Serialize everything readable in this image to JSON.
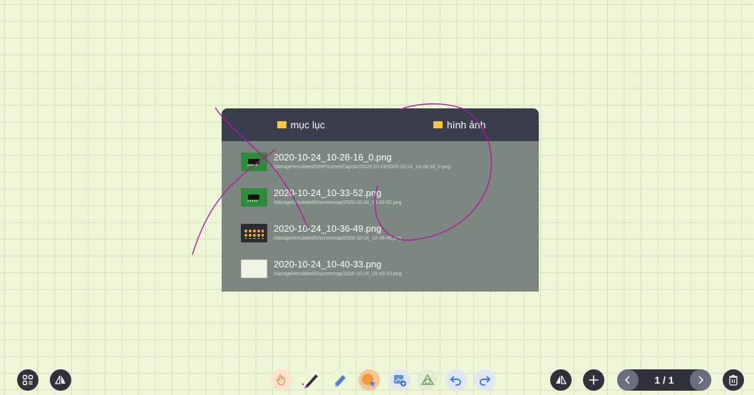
{
  "panel": {
    "tabs": [
      {
        "label": "mục lục",
        "icon": "folder-icon",
        "icon_color": "#f5c842"
      },
      {
        "label": "hình ảnh",
        "icon": "image-icon",
        "icon_color": "#f5c842"
      }
    ],
    "files": [
      {
        "name": "2020-10-24_10-28-16_0.png",
        "path": "/storage/emulated/0/RPScreenCap/pic/2020-10-24/2020-10-24_10-28-16_0.png"
      },
      {
        "name": "2020-10-24_10-33-52.png",
        "path": "/storage/emulated/0/screencap/2020-10-24_10-33-52.png"
      },
      {
        "name": "2020-10-24_10-36-49.png",
        "path": "/storage/emulated/0/screencap/2020-10-24_10-36-49.png"
      },
      {
        "name": "2020-10-24_10-40-33.png",
        "path": "/storage/emulated/0/screencap/2020-10-24_10-40-33.png"
      }
    ]
  },
  "toolbar": {
    "left": [
      "grid-menu-icon",
      "flip-icon"
    ],
    "tools": [
      "hand-icon",
      "pen-icon",
      "eraser-icon",
      "select-icon",
      "insert-image-icon",
      "shape-icon",
      "undo-icon",
      "redo-icon"
    ],
    "right": [
      "flip-icon",
      "add-page-icon",
      "delete-icon"
    ]
  },
  "pager": {
    "text": "1 / 1"
  },
  "colors": {
    "ink": "#b5179e",
    "panel_header": "#3a3d4c",
    "panel_body": "#7c8781",
    "background": "#eef6d8"
  }
}
